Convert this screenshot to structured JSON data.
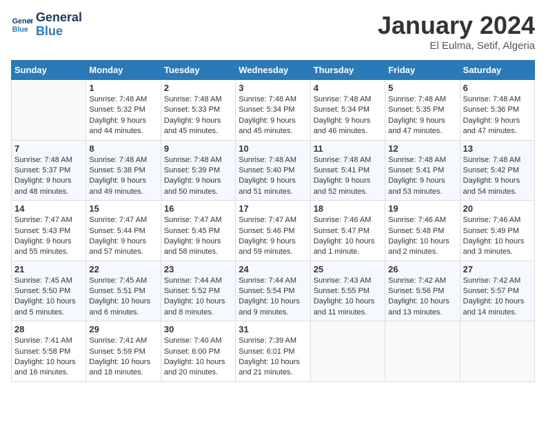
{
  "header": {
    "logo_line1": "General",
    "logo_line2": "Blue",
    "month_year": "January 2024",
    "location": "El Eulma, Setif, Algeria"
  },
  "weekdays": [
    "Sunday",
    "Monday",
    "Tuesday",
    "Wednesday",
    "Thursday",
    "Friday",
    "Saturday"
  ],
  "weeks": [
    [
      {
        "day": "",
        "info": ""
      },
      {
        "day": "1",
        "info": "Sunrise: 7:48 AM\nSunset: 5:32 PM\nDaylight: 9 hours\nand 44 minutes."
      },
      {
        "day": "2",
        "info": "Sunrise: 7:48 AM\nSunset: 5:33 PM\nDaylight: 9 hours\nand 45 minutes."
      },
      {
        "day": "3",
        "info": "Sunrise: 7:48 AM\nSunset: 5:34 PM\nDaylight: 9 hours\nand 45 minutes."
      },
      {
        "day": "4",
        "info": "Sunrise: 7:48 AM\nSunset: 5:34 PM\nDaylight: 9 hours\nand 46 minutes."
      },
      {
        "day": "5",
        "info": "Sunrise: 7:48 AM\nSunset: 5:35 PM\nDaylight: 9 hours\nand 47 minutes."
      },
      {
        "day": "6",
        "info": "Sunrise: 7:48 AM\nSunset: 5:36 PM\nDaylight: 9 hours\nand 47 minutes."
      }
    ],
    [
      {
        "day": "7",
        "info": "Sunrise: 7:48 AM\nSunset: 5:37 PM\nDaylight: 9 hours\nand 48 minutes."
      },
      {
        "day": "8",
        "info": "Sunrise: 7:48 AM\nSunset: 5:38 PM\nDaylight: 9 hours\nand 49 minutes."
      },
      {
        "day": "9",
        "info": "Sunrise: 7:48 AM\nSunset: 5:39 PM\nDaylight: 9 hours\nand 50 minutes."
      },
      {
        "day": "10",
        "info": "Sunrise: 7:48 AM\nSunset: 5:40 PM\nDaylight: 9 hours\nand 51 minutes."
      },
      {
        "day": "11",
        "info": "Sunrise: 7:48 AM\nSunset: 5:41 PM\nDaylight: 9 hours\nand 52 minutes."
      },
      {
        "day": "12",
        "info": "Sunrise: 7:48 AM\nSunset: 5:41 PM\nDaylight: 9 hours\nand 53 minutes."
      },
      {
        "day": "13",
        "info": "Sunrise: 7:48 AM\nSunset: 5:42 PM\nDaylight: 9 hours\nand 54 minutes."
      }
    ],
    [
      {
        "day": "14",
        "info": "Sunrise: 7:47 AM\nSunset: 5:43 PM\nDaylight: 9 hours\nand 55 minutes."
      },
      {
        "day": "15",
        "info": "Sunrise: 7:47 AM\nSunset: 5:44 PM\nDaylight: 9 hours\nand 57 minutes."
      },
      {
        "day": "16",
        "info": "Sunrise: 7:47 AM\nSunset: 5:45 PM\nDaylight: 9 hours\nand 58 minutes."
      },
      {
        "day": "17",
        "info": "Sunrise: 7:47 AM\nSunset: 5:46 PM\nDaylight: 9 hours\nand 59 minutes."
      },
      {
        "day": "18",
        "info": "Sunrise: 7:46 AM\nSunset: 5:47 PM\nDaylight: 10 hours\nand 1 minute."
      },
      {
        "day": "19",
        "info": "Sunrise: 7:46 AM\nSunset: 5:48 PM\nDaylight: 10 hours\nand 2 minutes."
      },
      {
        "day": "20",
        "info": "Sunrise: 7:46 AM\nSunset: 5:49 PM\nDaylight: 10 hours\nand 3 minutes."
      }
    ],
    [
      {
        "day": "21",
        "info": "Sunrise: 7:45 AM\nSunset: 5:50 PM\nDaylight: 10 hours\nand 5 minutes."
      },
      {
        "day": "22",
        "info": "Sunrise: 7:45 AM\nSunset: 5:51 PM\nDaylight: 10 hours\nand 6 minutes."
      },
      {
        "day": "23",
        "info": "Sunrise: 7:44 AM\nSunset: 5:52 PM\nDaylight: 10 hours\nand 8 minutes."
      },
      {
        "day": "24",
        "info": "Sunrise: 7:44 AM\nSunset: 5:54 PM\nDaylight: 10 hours\nand 9 minutes."
      },
      {
        "day": "25",
        "info": "Sunrise: 7:43 AM\nSunset: 5:55 PM\nDaylight: 10 hours\nand 11 minutes."
      },
      {
        "day": "26",
        "info": "Sunrise: 7:42 AM\nSunset: 5:56 PM\nDaylight: 10 hours\nand 13 minutes."
      },
      {
        "day": "27",
        "info": "Sunrise: 7:42 AM\nSunset: 5:57 PM\nDaylight: 10 hours\nand 14 minutes."
      }
    ],
    [
      {
        "day": "28",
        "info": "Sunrise: 7:41 AM\nSunset: 5:58 PM\nDaylight: 10 hours\nand 16 minutes."
      },
      {
        "day": "29",
        "info": "Sunrise: 7:41 AM\nSunset: 5:59 PM\nDaylight: 10 hours\nand 18 minutes."
      },
      {
        "day": "30",
        "info": "Sunrise: 7:40 AM\nSunset: 6:00 PM\nDaylight: 10 hours\nand 20 minutes."
      },
      {
        "day": "31",
        "info": "Sunrise: 7:39 AM\nSunset: 6:01 PM\nDaylight: 10 hours\nand 21 minutes."
      },
      {
        "day": "",
        "info": ""
      },
      {
        "day": "",
        "info": ""
      },
      {
        "day": "",
        "info": ""
      }
    ]
  ]
}
